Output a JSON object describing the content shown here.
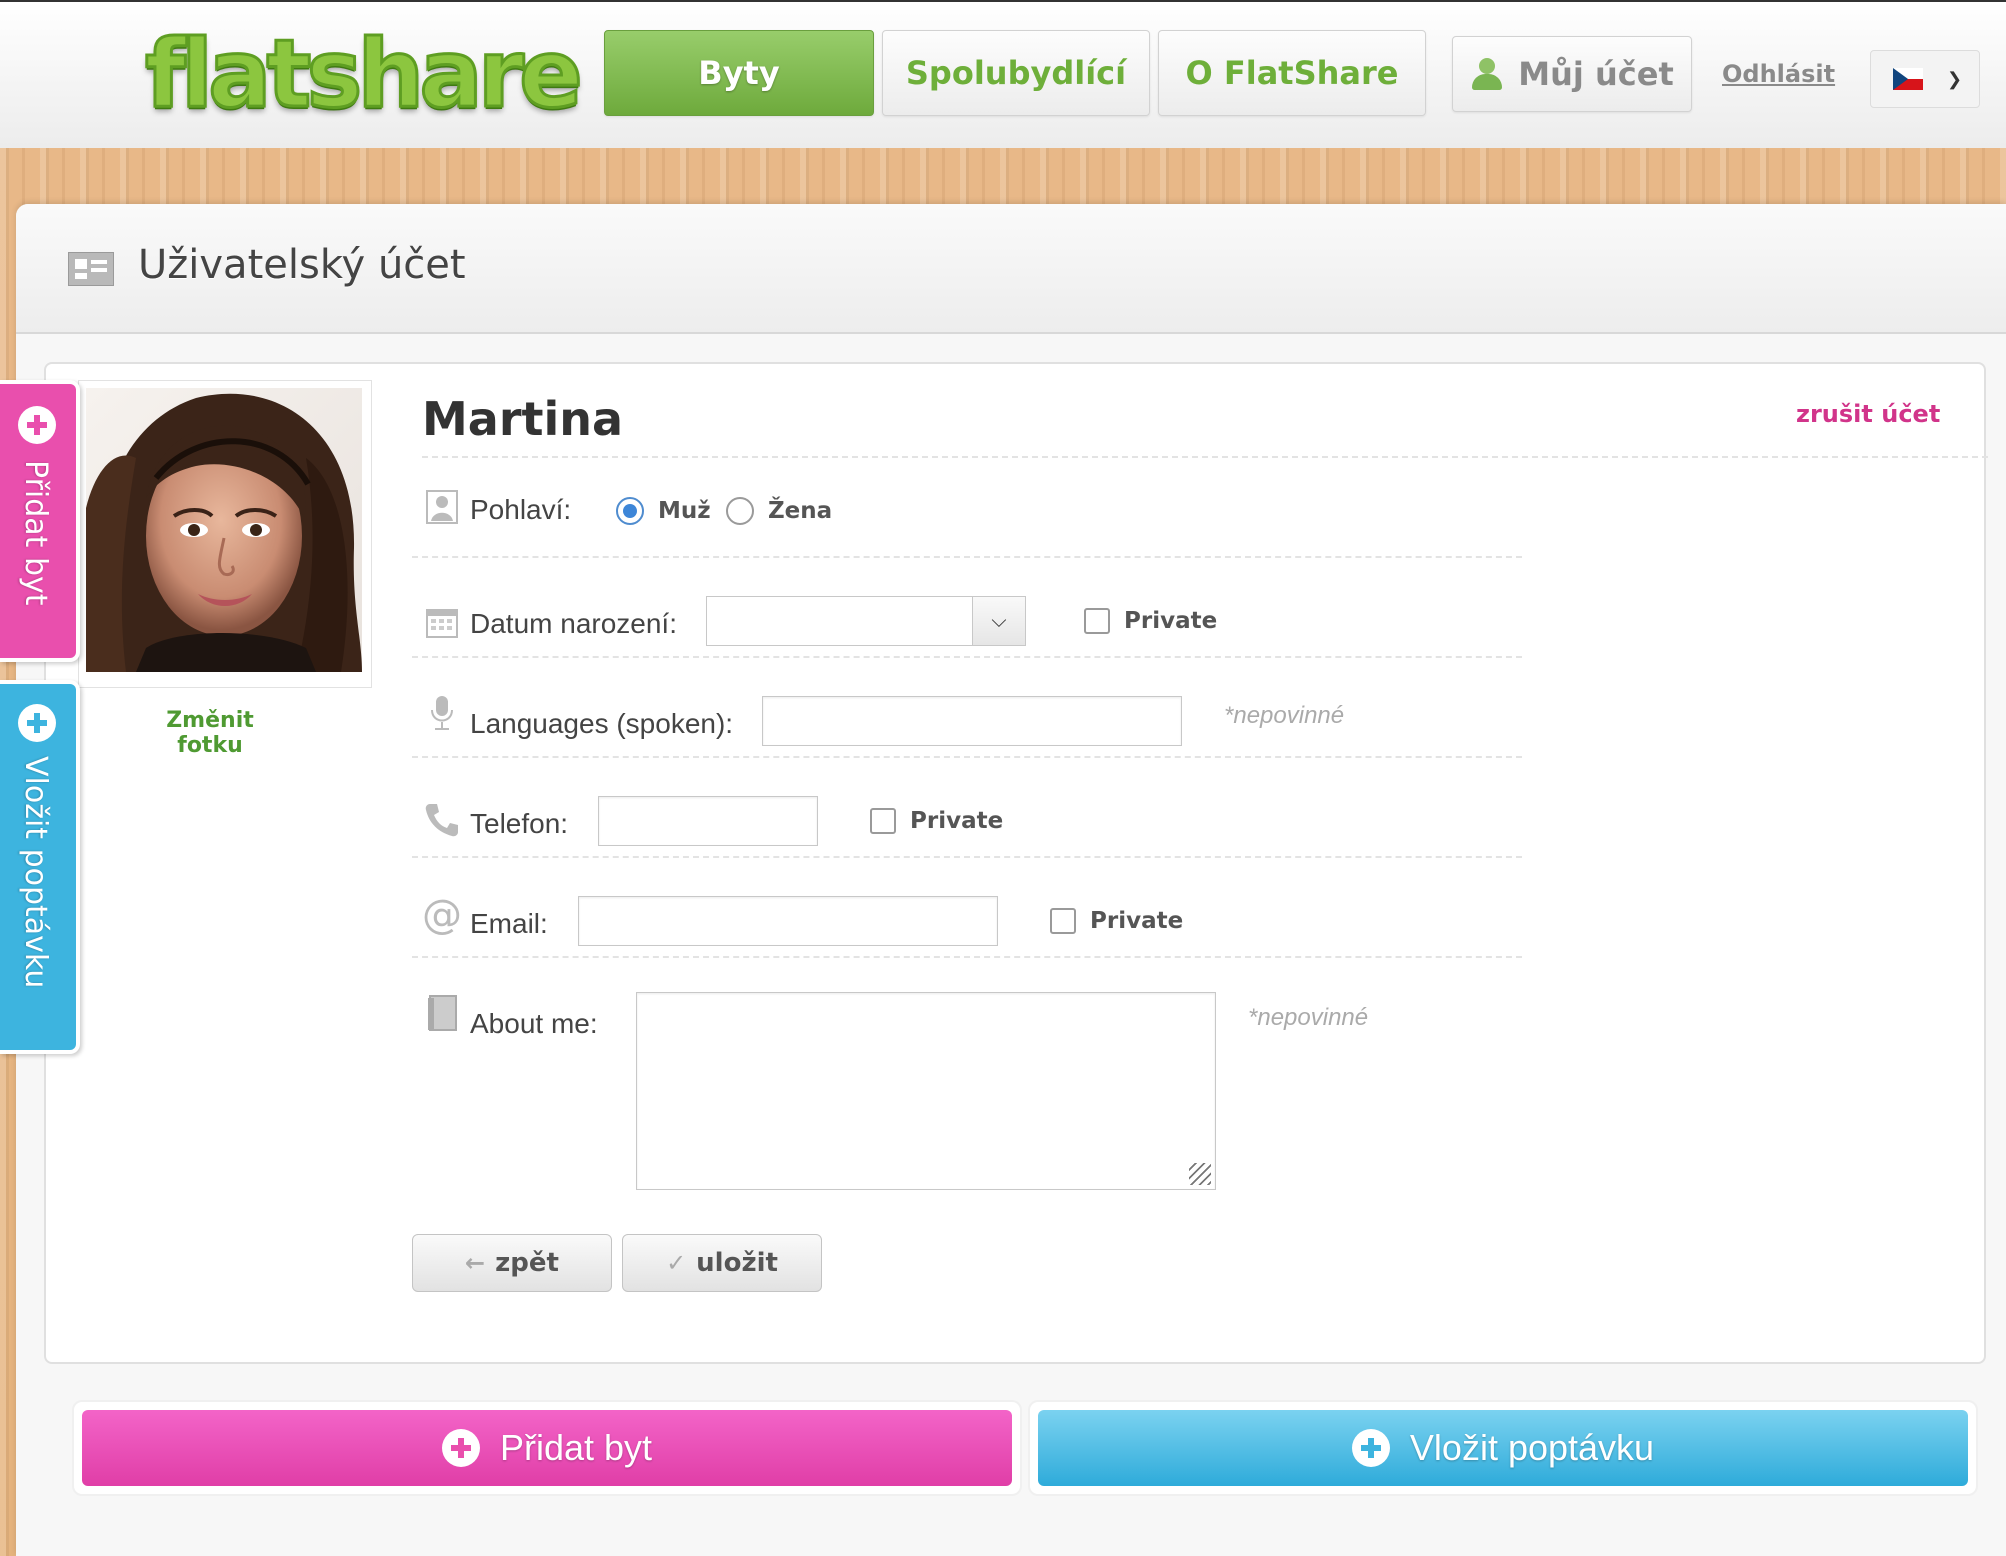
{
  "brand": {
    "logo_text": "flatshare"
  },
  "nav": {
    "items": [
      {
        "label": "Byty",
        "active": true
      },
      {
        "label": "Spolubydlící",
        "active": false
      },
      {
        "label": "O FlatShare",
        "active": false
      }
    ],
    "account_label": "Můj účet",
    "logout_label": "Odhlásit",
    "language": {
      "selected": "cz-flag-icon"
    }
  },
  "page": {
    "title": "Uživatelský účet"
  },
  "profile": {
    "name": "Martina",
    "change_photo_label": "Změnit fotku",
    "delete_account_label": "zrušit účet"
  },
  "form": {
    "gender": {
      "label": "Pohlaví:",
      "options": [
        "Muž",
        "Žena"
      ],
      "selected": "Muž"
    },
    "birthdate": {
      "label": "Datum narození:",
      "value": "",
      "private_label": "Private",
      "private_checked": false
    },
    "languages": {
      "label": "Languages (spoken):",
      "value": "",
      "hint": "*nepovinné"
    },
    "phone": {
      "label": "Telefon:",
      "value": "",
      "private_label": "Private",
      "private_checked": false
    },
    "email": {
      "label": "Email:",
      "value": "",
      "private_label": "Private",
      "private_checked": false
    },
    "about": {
      "label": "About me:",
      "value": "",
      "hint": "*nepovinné"
    },
    "back_label": "zpět",
    "save_label": "uložit"
  },
  "side_tabs": {
    "add_flat": "Přidat byt",
    "add_request": "Vložit poptávku"
  },
  "bottom_actions": {
    "add_flat": "Přidat byt",
    "add_request": "Vložit poptávku"
  },
  "colors": {
    "brand_green": "#6eaf3a",
    "pink": "#e94fad",
    "blue": "#3db4df",
    "delete_link": "#d1348a"
  }
}
